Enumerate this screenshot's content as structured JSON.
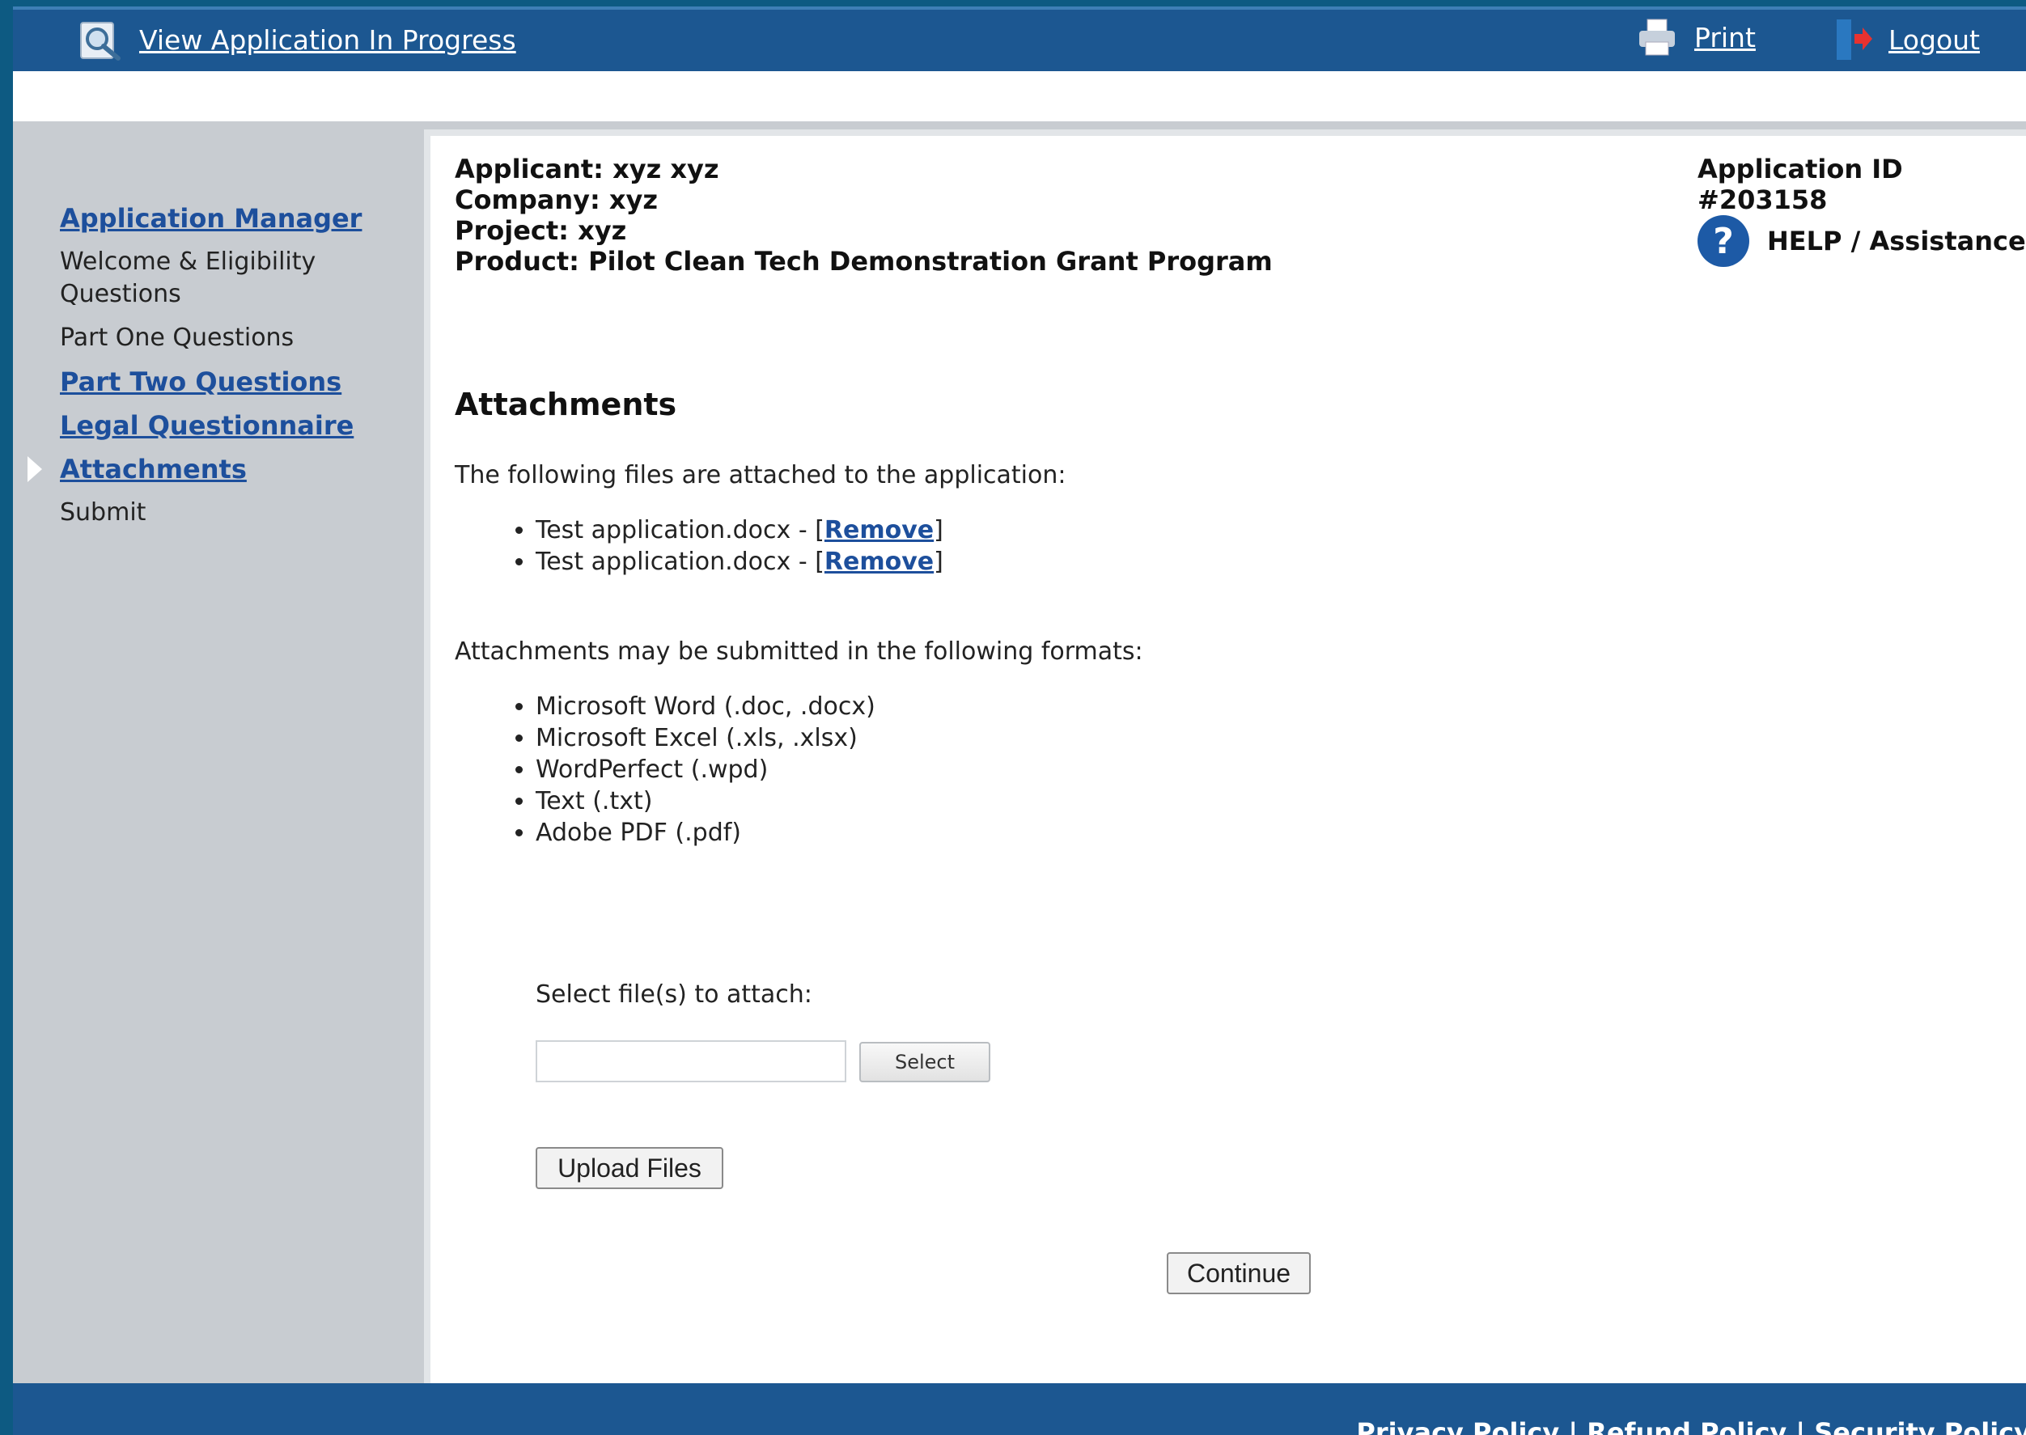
{
  "topbar": {
    "view_app_label": "View Application In Progress",
    "print_label": "Print",
    "logout_label": "Logout"
  },
  "sidebar": {
    "items": [
      {
        "label": "Application Manager"
      },
      {
        "label": "Welcome & Eligibility Questions"
      },
      {
        "label": "Part One Questions"
      },
      {
        "label": "Part Two Questions"
      },
      {
        "label": "Legal Questionnaire"
      },
      {
        "label": "Attachments"
      },
      {
        "label": "Submit"
      }
    ]
  },
  "header": {
    "applicant": "Applicant: xyz xyz",
    "company": "Company: xyz",
    "project": "Project: xyz",
    "product": "Product: Pilot Clean Tech Demonstration Grant Program",
    "app_id": "Application ID #203158",
    "help_label": "HELP / Assistance"
  },
  "attachments": {
    "title": "Attachments",
    "intro": "The following files are attached to the application:",
    "files": [
      {
        "name": "Test application.docx - ",
        "remove_label": "Remove"
      },
      {
        "name": "Test application.docx - ",
        "remove_label": "Remove"
      }
    ],
    "formats_intro": "Attachments may be submitted in the following formats:",
    "formats": [
      "Microsoft Word (.doc, .docx)",
      "Microsoft Excel (.xls, .xlsx)",
      "WordPerfect (.wpd)",
      "Text (.txt)",
      "Adobe PDF (.pdf)"
    ],
    "select_label": "Select file(s) to attach:",
    "select_button": "Select",
    "upload_button": "Upload Files",
    "continue_button": "Continue"
  },
  "footer": {
    "privacy": "Privacy Policy",
    "refund": "Refund Policy",
    "security": "Security Policy",
    "separator": " | "
  },
  "colors": {
    "topbar": "#1c5791",
    "link": "#1d4f9c",
    "sidebar_bg": "#c8ccd1"
  }
}
